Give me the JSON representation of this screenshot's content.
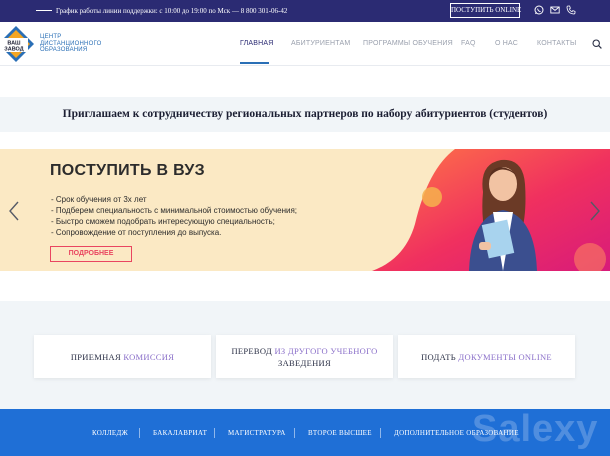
{
  "topbar": {
    "schedule": "График работы линии поддержки: с 10:00 до 19:00 по Мск — 8 800 301-06-42",
    "online_button": "ПОСТУПИТЬ ONLINE",
    "icons": [
      "whatsapp-icon",
      "mail-icon",
      "phone-icon"
    ]
  },
  "logo": {
    "mark_text": [
      "ВАШ",
      "ЗАВОД"
    ],
    "lines": [
      "ЦЕНТР",
      "ДИСТАНЦИОННОГО",
      "ОБРАЗОВАНИЯ"
    ]
  },
  "nav": {
    "items": [
      "ГЛАВНАЯ",
      "АБИТУРИЕНТАМ",
      "ПРОГРАММЫ ОБУЧЕНИЯ",
      "FAQ",
      "О НАС",
      "КОНТАКТЫ"
    ],
    "active": "ГЛАВНАЯ"
  },
  "invite": {
    "text": "Приглашаем к сотрудничеству региональных партнеров по набору абитуриентов (студентов)"
  },
  "hero": {
    "title": "ПОСТУПИТЬ В ВУЗ",
    "bullets": [
      "- Срок обучения от 3х лет",
      "- Подберем специальность с минимальной стоимостью обучения;",
      "- Быстро сможем подобрать интересующую специальность;",
      "- Сопровождение от поступления до выпуска."
    ],
    "button": "ПОДРОБНЕЕ"
  },
  "cards": [
    {
      "plain": "ПРИЕМНАЯ ",
      "accent": "КОМИССИЯ"
    },
    {
      "line1_plain": "ПЕРЕВОД ",
      "line1_accent": "ИЗ ДРУГОГО УЧЕБНОГО",
      "line2": "ЗАВЕДЕНИЯ"
    },
    {
      "plain": "ПОДАТЬ ",
      "accent": "ДОКУМЕНТЫ ONLINE"
    }
  ],
  "footer": {
    "items": [
      "КОЛЛЕДЖ",
      "БАКАЛАВРИАТ",
      "МАГИСТРАТУРА",
      "ВТОРОЕ ВЫСШЕЕ",
      "ДОПОЛНИТЕЛЬНОЕ ОБРАЗОВАНИЕ"
    ]
  },
  "watermark": "Salexy",
  "colors": {
    "topbar": "#2b2b73",
    "accent_blue": "#2a6fb6",
    "hero_bg": "#fbe9c4",
    "hero_pink": "#e94560",
    "card_accent": "#8a6fc9",
    "footer": "#1f6fd6"
  }
}
